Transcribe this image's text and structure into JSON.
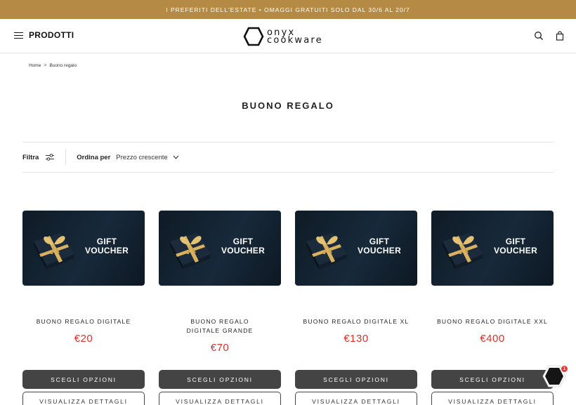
{
  "announcement": "I PREFERITI DELL'ESTATE • OMAGGI GRATUITI SOLO DAL 30/6 AL 20/7",
  "header": {
    "menu_label": "PRODOTTI",
    "logo_line1": "onyx",
    "logo_line2": "cookware"
  },
  "breadcrumb": {
    "home": "Home",
    "separator": ">",
    "current": "Buono regalo"
  },
  "page_title": "BUONO REGALO",
  "filters": {
    "filter_label": "Filtra",
    "sort_label": "Ordina per",
    "sort_value": "Prezzo crescente"
  },
  "voucher_image_text": {
    "line1": "GIFT",
    "line2": "VOUCHER"
  },
  "products": [
    {
      "title": "BUONO REGALO DIGITALE",
      "price": "€20",
      "primary_button": "SCEGLI OPZIONI",
      "secondary_button": "VISUALIZZA DETTAGLI"
    },
    {
      "title": "BUONO REGALO DIGITALE GRANDE",
      "price": "€70",
      "primary_button": "SCEGLI OPZIONI",
      "secondary_button": "VISUALIZZA DETTAGLI"
    },
    {
      "title": "BUONO REGALO DIGITALE XL",
      "price": "€130",
      "primary_button": "SCEGLI OPZIONI",
      "secondary_button": "VISUALIZZA DETTAGLI"
    },
    {
      "title": "BUONO REGALO DIGITALE XXL",
      "price": "€400",
      "primary_button": "SCEGLI OPZIONI",
      "secondary_button": "VISUALIZZA DETTAGLI"
    }
  ],
  "chat": {
    "badge_count": "1"
  },
  "colors": {
    "announcement_bg": "#b58a45",
    "price": "#d9332b",
    "button_dark": "#444444",
    "card_bg": "#13222f"
  },
  "icons": [
    "hamburger-icon",
    "search-icon",
    "bag-icon",
    "chevron-right-icon",
    "filter-sliders-icon",
    "chevron-down-icon",
    "gift-box-icon",
    "chat-hexagon-icon"
  ]
}
